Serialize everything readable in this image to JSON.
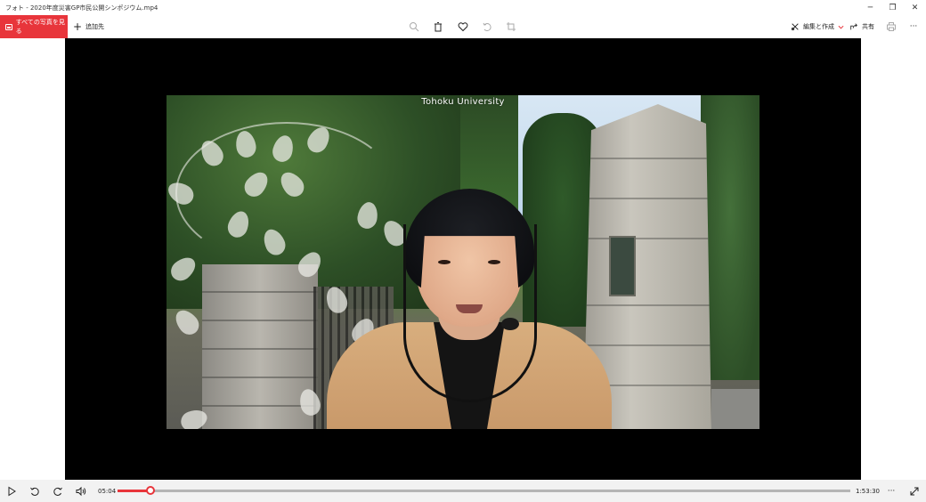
{
  "window": {
    "title": "フォト - 2020年度災害GP市民公開シンポジウム.mp4",
    "minimize_glyph": "─",
    "restore_glyph": "❐",
    "close_glyph": "✕"
  },
  "toolbar": {
    "see_all_label": "すべての写真を見る",
    "add_to_label": "追加先",
    "edit_create_label": "編集と作成",
    "share_label": "共有",
    "more_glyph": "···",
    "icons": [
      "zoom-icon",
      "delete-icon",
      "favorite-icon",
      "rotate-icon",
      "crop-icon",
      "print-icon"
    ]
  },
  "video": {
    "watermark": "Tohoku University"
  },
  "player": {
    "current_time": "05:04",
    "total_time": "1:53:30",
    "progress": 0.0447,
    "more_glyph": "···",
    "accent": "#e8353b"
  }
}
